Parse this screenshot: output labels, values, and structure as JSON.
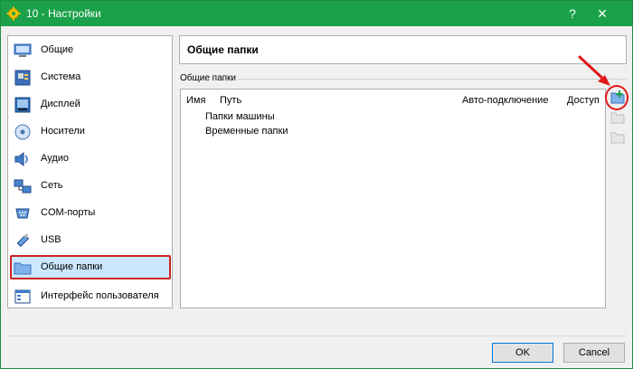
{
  "window": {
    "title": "10 - Настройки",
    "help_glyph": "?",
    "close_glyph": "✕",
    "accent_color": "#1aa14a",
    "highlight_color": "#e01818"
  },
  "sidebar": {
    "items": [
      {
        "label": "Общие",
        "icon": "monitor-icon"
      },
      {
        "label": "Система",
        "icon": "motherboard-icon"
      },
      {
        "label": "Дисплей",
        "icon": "display-icon"
      },
      {
        "label": "Носители",
        "icon": "storage-icon"
      },
      {
        "label": "Аудио",
        "icon": "speaker-icon"
      },
      {
        "label": "Сеть",
        "icon": "network-icon"
      },
      {
        "label": "COM-порты",
        "icon": "serial-port-icon"
      },
      {
        "label": "USB",
        "icon": "usb-icon"
      },
      {
        "label": "Общие папки",
        "icon": "folder-icon",
        "selected": true
      },
      {
        "label": "Интерфейс пользователя",
        "icon": "window-icon"
      }
    ]
  },
  "main": {
    "header_title": "Общие папки",
    "group_label": "Общие папки",
    "columns": [
      "Имя",
      "Путь",
      "Авто-подключение",
      "Доступ"
    ],
    "rows": [
      "Папки машины",
      "Временные папки"
    ],
    "tools": [
      "add-folder-icon",
      "edit-folder-icon",
      "remove-folder-icon"
    ]
  },
  "buttons": {
    "ok": "OK",
    "cancel": "Cancel"
  }
}
